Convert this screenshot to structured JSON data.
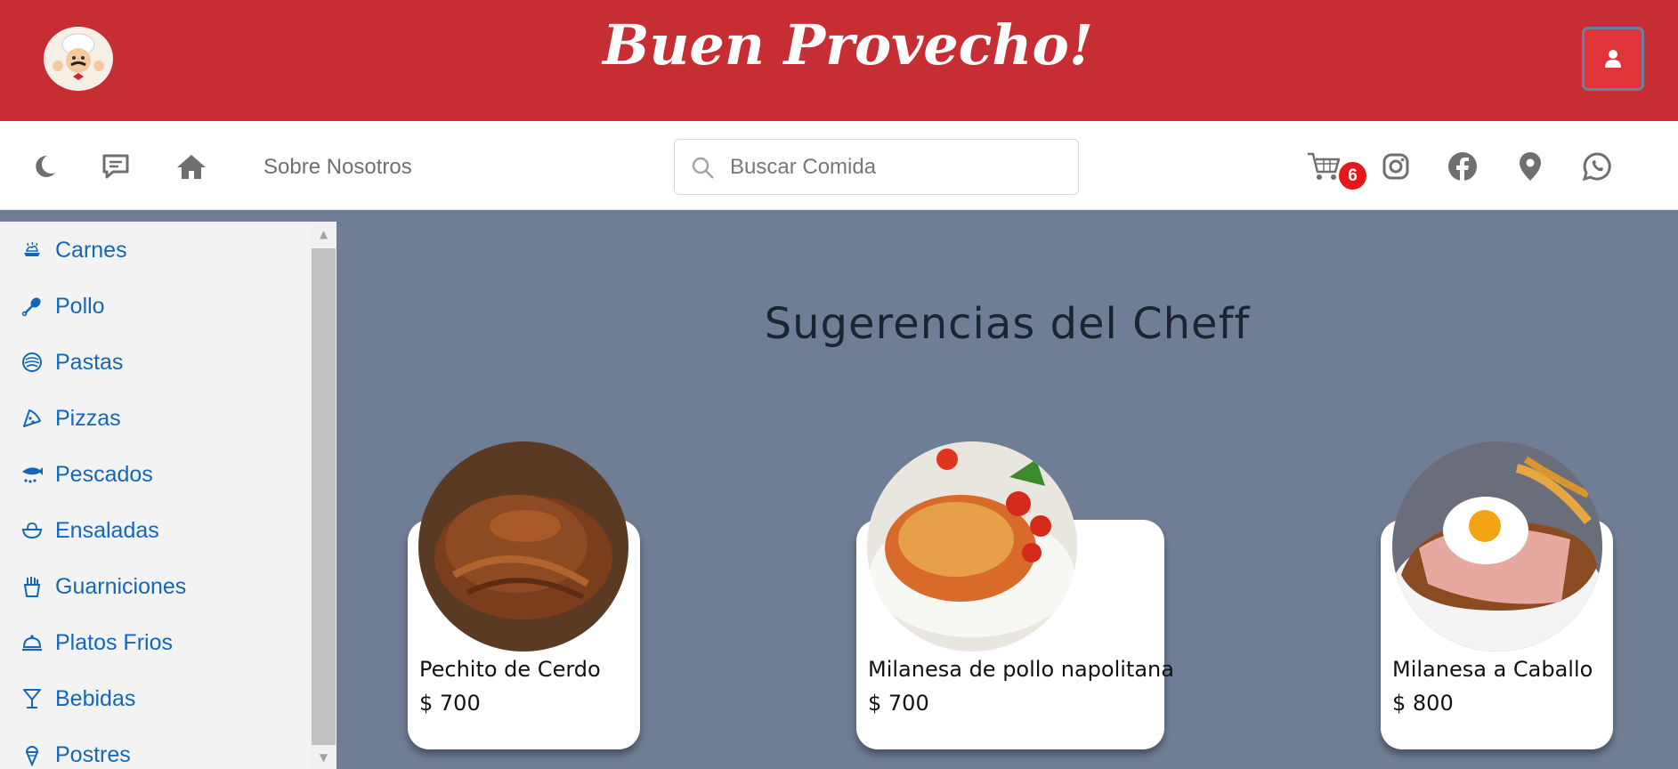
{
  "header": {
    "brand": "Buen Provecho!"
  },
  "nav": {
    "about_label": "Sobre Nosotros",
    "search_placeholder": "Buscar Comida",
    "cart_count": "6"
  },
  "sidebar": {
    "items": [
      {
        "label": "Carnes",
        "icon": "meat-icon"
      },
      {
        "label": "Pollo",
        "icon": "drumstick-icon"
      },
      {
        "label": "Pastas",
        "icon": "pasta-icon"
      },
      {
        "label": "Pizzas",
        "icon": "pizza-icon"
      },
      {
        "label": "Pescados",
        "icon": "fish-icon"
      },
      {
        "label": "Ensaladas",
        "icon": "salad-icon"
      },
      {
        "label": "Guarniciones",
        "icon": "fries-icon"
      },
      {
        "label": "Platos Frios",
        "icon": "cloche-icon"
      },
      {
        "label": "Bebidas",
        "icon": "cocktail-icon"
      },
      {
        "label": "Postres",
        "icon": "ice-cream-icon"
      }
    ]
  },
  "main": {
    "title": "Sugerencias del Cheff",
    "cards": [
      {
        "name": "Pechito de Cerdo",
        "price": "$ 700"
      },
      {
        "name": "Milanesa de pollo napolitana",
        "price": "$ 700"
      },
      {
        "name": "Milanesa a Caballo",
        "price": "$ 800"
      }
    ]
  },
  "colors": {
    "header_red": "#c62e33",
    "link_blue": "#1467b8",
    "page_bg": "#6f7e95",
    "badge_red": "#e4181b"
  }
}
